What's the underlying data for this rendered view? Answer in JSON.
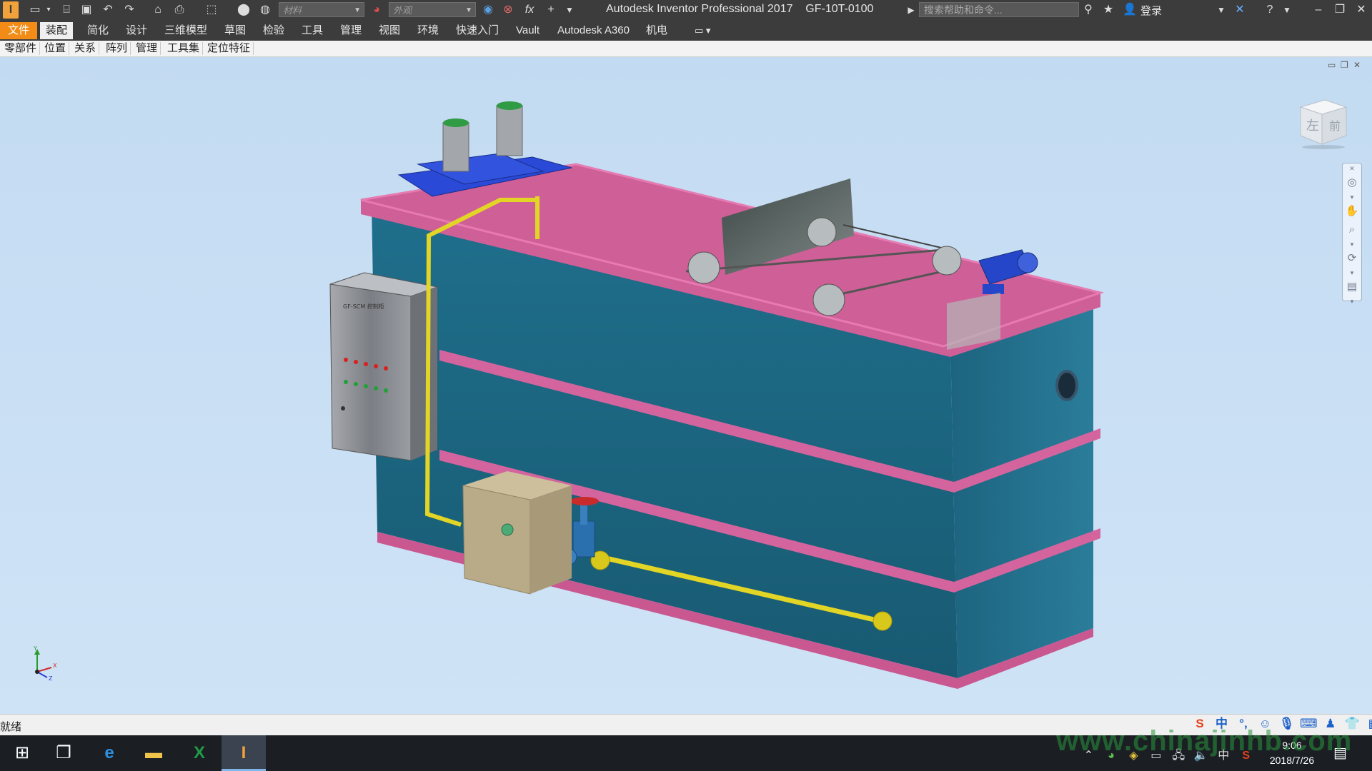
{
  "app": {
    "logo_text": "I",
    "title": "Autodesk Inventor Professional 2017",
    "document": "GF-10T-0100",
    "material_placeholder": "材料",
    "appearance_placeholder": "外观",
    "help_search_placeholder": "搜索帮助和命令...",
    "login_label": "登录",
    "fx_label": "fx"
  },
  "ribbon": {
    "file_tab": "文件",
    "tabs": [
      "装配",
      "简化",
      "设计",
      "三维模型",
      "草图",
      "检验",
      "工具",
      "管理",
      "视图",
      "环境",
      "快速入门",
      "Vault",
      "Autodesk A360",
      "机电"
    ],
    "active_tab": "装配"
  },
  "panels": [
    "零部件",
    "位置",
    "关系",
    "阵列",
    "管理",
    "工具集",
    "定位特征"
  ],
  "viewcube": {
    "left": "左",
    "front": "前"
  },
  "control_panel_label": "GF-SCM 控制柜",
  "axis": {
    "x": "X",
    "y": "Y",
    "z": "Z"
  },
  "status": {
    "text": "就绪"
  },
  "ime": {
    "mode": "中",
    "punct": "°,"
  },
  "taskbar": {
    "tray_lang": "中",
    "time": "9:06",
    "date": "2018/7/26",
    "excel_label": "X",
    "inventor_label": "I"
  },
  "watermark": "www.chinajinhb.com",
  "colors": {
    "tank": "#1d6a86",
    "rim": "#d4649d",
    "pipe": "#e0d22a",
    "box": "#b8ab8a",
    "cabinet": "#8e9094",
    "motor_base": "#2442c9",
    "viewport": "#c7def4"
  }
}
